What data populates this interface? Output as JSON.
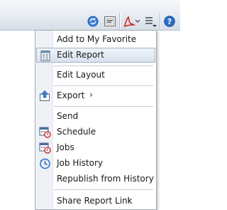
{
  "menu": {
    "items": [
      {
        "label": "Add to My Favorite"
      },
      {
        "label": "Edit Report",
        "icon": "edit-report-icon",
        "selected": true
      },
      {
        "label": "Edit Layout"
      },
      {
        "label": "Export",
        "icon": "export-icon",
        "submenu": true
      },
      {
        "label": "Send"
      },
      {
        "label": "Schedule",
        "icon": "schedule-icon"
      },
      {
        "label": "Jobs",
        "icon": "jobs-icon"
      },
      {
        "label": "Job History",
        "icon": "job-history-icon"
      },
      {
        "label": "Republish from History"
      },
      {
        "label": "Share Report Link",
        "submenu": true
      }
    ],
    "submenu_arrow": "›"
  },
  "colors": {
    "selected_border": "#9fb3c8",
    "accent_blue": "#2a6fc9",
    "pdf_red": "#d22a2a"
  }
}
